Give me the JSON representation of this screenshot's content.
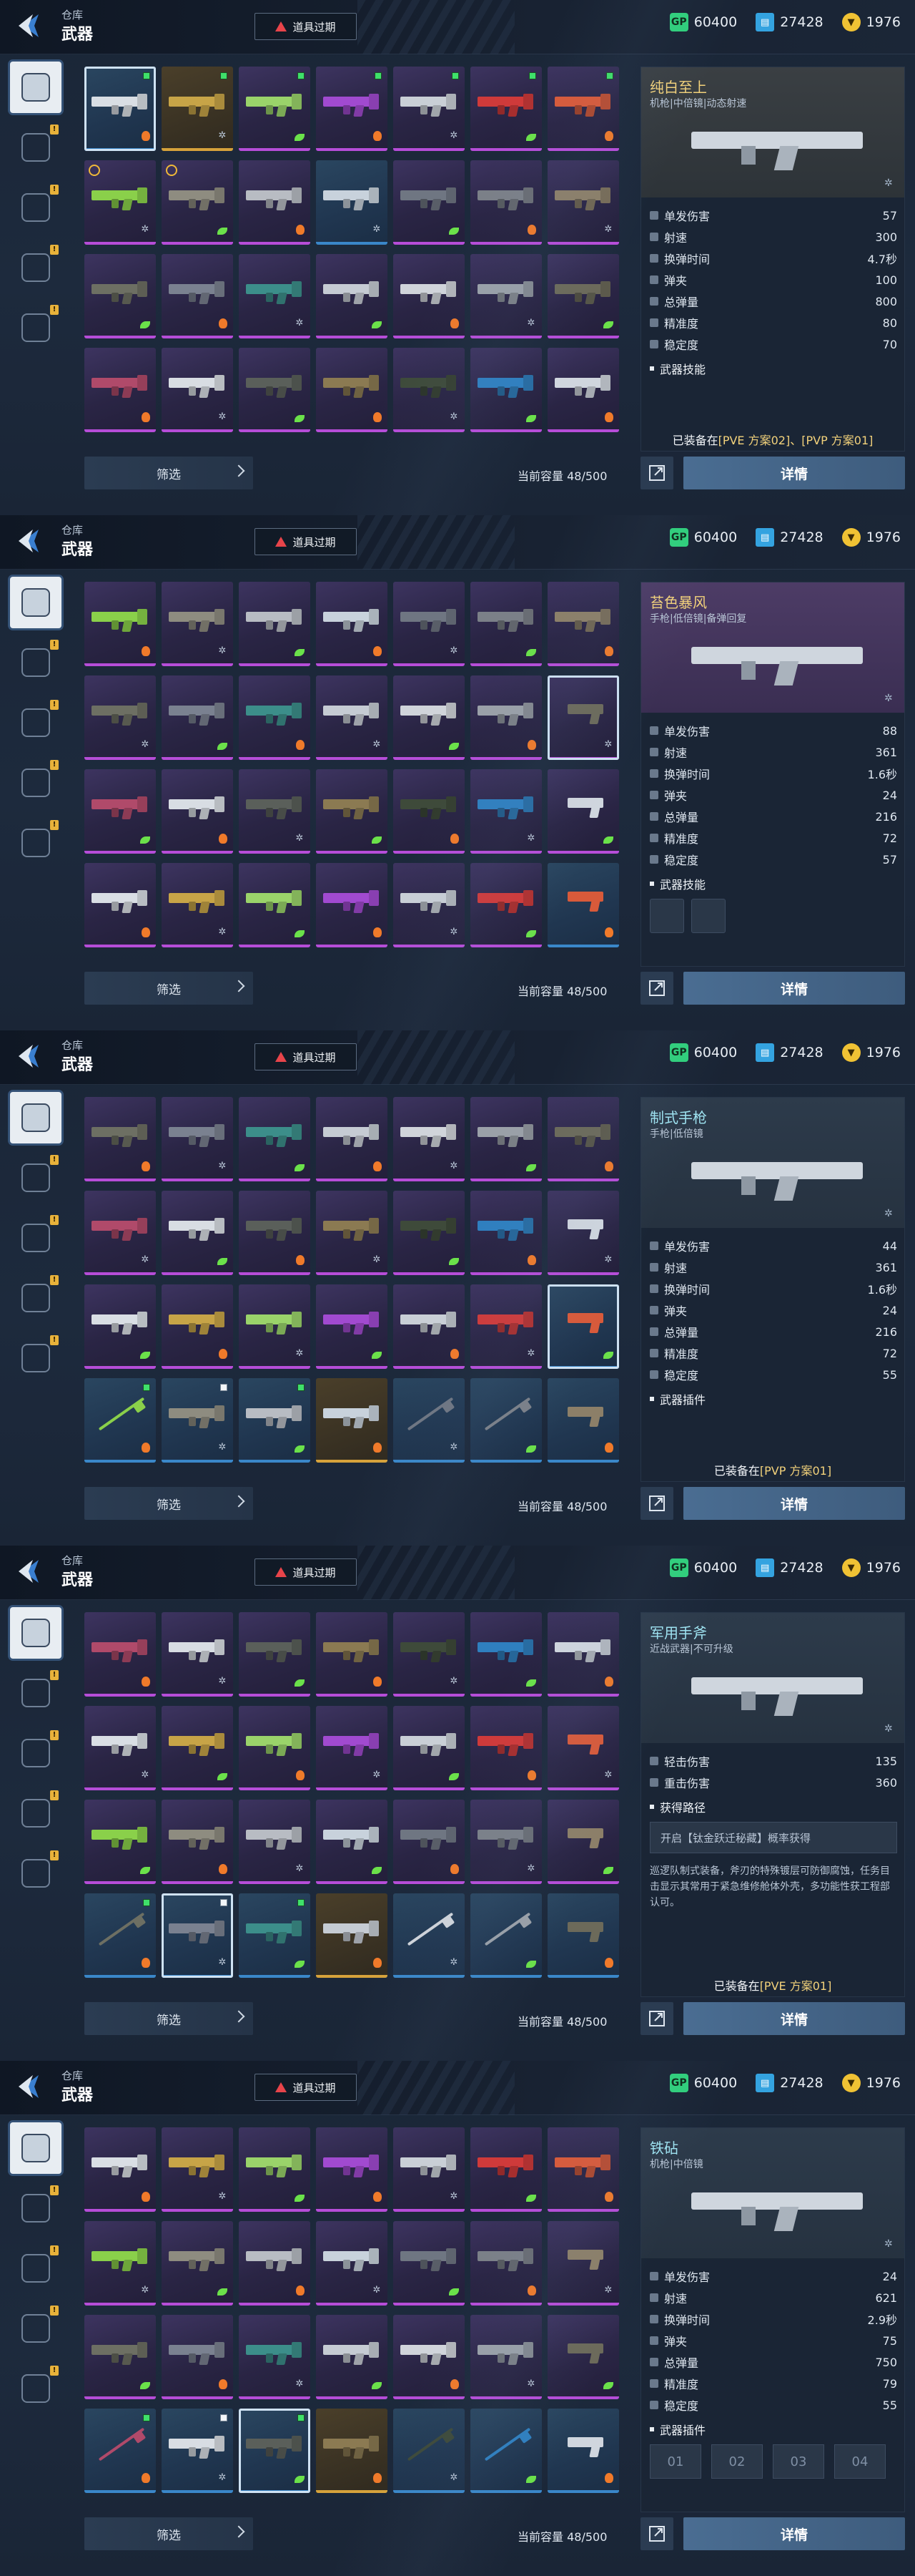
{
  "header": {
    "section": "仓库",
    "title": "武器",
    "expired_label": "道具过期",
    "currencies": [
      {
        "icon": "gp-icon",
        "label": "GP",
        "value": "60400"
      },
      {
        "icon": "ticket-card-icon",
        "label": "",
        "value": "27428"
      },
      {
        "icon": "coin-icon",
        "label": "",
        "value": "1976"
      }
    ]
  },
  "sidebar": {
    "tabs": [
      {
        "name": "sidebar-tab-guns",
        "icon": "pistol-icon",
        "active": true,
        "badge": ""
      },
      {
        "name": "sidebar-tab-gear",
        "icon": "gear-icon",
        "active": false,
        "badge": "!"
      },
      {
        "name": "sidebar-tab-consumables",
        "icon": "grenade-icon",
        "active": false,
        "badge": "!"
      },
      {
        "name": "sidebar-tab-vehicles",
        "icon": "drone-icon",
        "active": false,
        "badge": "!"
      },
      {
        "name": "sidebar-tab-misc",
        "icon": "character-icon",
        "active": false,
        "badge": "!"
      }
    ]
  },
  "footer": {
    "filter_label": "筛选",
    "capacity_label": "当前容量 48/500",
    "detail_label": "详情"
  },
  "screens": [
    {
      "panel": {
        "name": "纯白至上",
        "subtitle": "机枪|中倍镜|动态射速",
        "color": "#f3d27b",
        "stats": [
          {
            "label": "单发伤害",
            "value": "57"
          },
          {
            "label": "射速",
            "value": "300"
          },
          {
            "label": "换弹时间",
            "value": "4.7秒"
          },
          {
            "label": "弹夹",
            "value": "100"
          },
          {
            "label": "总弹量",
            "value": "800"
          },
          {
            "label": "精准度",
            "value": "80"
          },
          {
            "label": "稳定度",
            "value": "70"
          }
        ],
        "section": "武器技能",
        "equip_prefix": "已装备在",
        "equip_value": "[PVE 方案02]、[PVP 方案01]"
      }
    },
    {
      "panel": {
        "name": "苔色暴风",
        "subtitle": "手枪|低倍镜|备弹回复",
        "color": "#f3d27b",
        "stats": [
          {
            "label": "单发伤害",
            "value": "88"
          },
          {
            "label": "射速",
            "value": "361"
          },
          {
            "label": "换弹时间",
            "value": "1.6秒"
          },
          {
            "label": "弹夹",
            "value": "24"
          },
          {
            "label": "总弹量",
            "value": "216"
          },
          {
            "label": "精准度",
            "value": "72"
          },
          {
            "label": "稳定度",
            "value": "57"
          }
        ],
        "section": "武器技能"
      }
    },
    {
      "panel": {
        "name": "制式手枪",
        "subtitle": "手枪|低倍镜",
        "stats": [
          {
            "label": "单发伤害",
            "value": "44"
          },
          {
            "label": "射速",
            "value": "361"
          },
          {
            "label": "换弹时间",
            "value": "1.6秒"
          },
          {
            "label": "弹夹",
            "value": "24"
          },
          {
            "label": "总弹量",
            "value": "216"
          },
          {
            "label": "精准度",
            "value": "72"
          },
          {
            "label": "稳定度",
            "value": "55"
          }
        ],
        "section": "武器插件",
        "equip_prefix": "已装备在",
        "equip_value": "[PVP 方案01]"
      }
    },
    {
      "panel": {
        "name": "军用手斧",
        "subtitle": "近战武器|不可升级",
        "stats": [
          {
            "label": "轻击伤害",
            "value": "135"
          },
          {
            "label": "重击伤害",
            "value": "360"
          }
        ],
        "section": "获得路径",
        "acquire": "开启【钛金跃迁秘藏】概率获得",
        "description": "巡逻队制式装备，斧刃的特殊镀层可防御腐蚀，任务目击显示其常用于紧急维修舱体外壳，多功能性获工程部认可。",
        "equip_prefix": "已装备在",
        "equip_value": "[PVE 方案01]"
      }
    },
    {
      "panel": {
        "name": "铁砧",
        "subtitle": "机枪|中倍镜",
        "stats": [
          {
            "label": "单发伤害",
            "value": "24"
          },
          {
            "label": "射速",
            "value": "621"
          },
          {
            "label": "换弹时间",
            "value": "2.9秒"
          },
          {
            "label": "弹夹",
            "value": "75"
          },
          {
            "label": "总弹量",
            "value": "750"
          },
          {
            "label": "精准度",
            "value": "79"
          },
          {
            "label": "稳定度",
            "value": "55"
          }
        ],
        "section": "武器插件",
        "slots": [
          "01",
          "02",
          "03",
          "04"
        ]
      }
    }
  ]
}
